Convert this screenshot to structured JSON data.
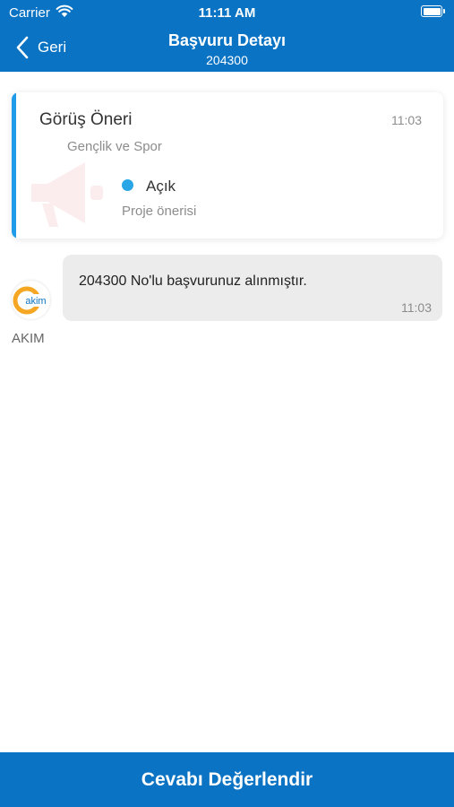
{
  "status_bar": {
    "carrier": "Carrier",
    "time": "11:11 AM"
  },
  "nav": {
    "back_label": "Geri",
    "title": "Başvuru Detayı",
    "subtitle": "204300"
  },
  "application": {
    "title": "Görüş Öneri",
    "time": "11:03",
    "category": "Gençlik ve Spor",
    "status": "Açık",
    "type": "Proje önerisi"
  },
  "message": {
    "sender": "AKIM",
    "avatar_text": "akim",
    "text": "204300 No'lu başvurunuz alınmıştır.",
    "time": "11:03"
  },
  "footer": {
    "button_label": "Cevabı Değerlendir"
  },
  "colors": {
    "brand": "#0a73c4",
    "accent": "#1e9be9",
    "status_open": "#2aa5e6",
    "logo_orange": "#f5a623"
  },
  "icons": {
    "back": "chevron-left-icon",
    "card_background": "megaphone-icon",
    "wifi": "wifi-icon",
    "battery": "battery-icon"
  }
}
